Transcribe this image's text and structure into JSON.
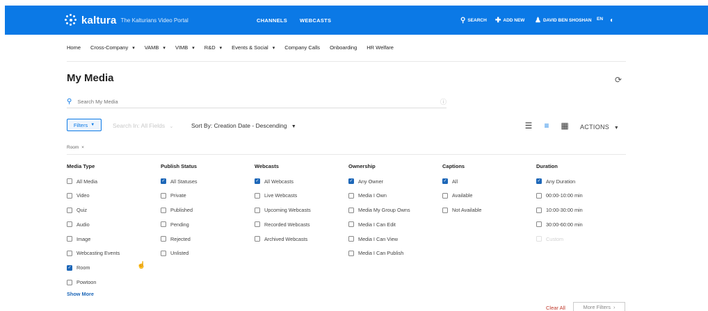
{
  "topbar": {
    "logo": "kaltura",
    "subtitle": "The Kalturians Video Portal",
    "nav": [
      "CHANNELS",
      "WEBCASTS"
    ],
    "search": "SEARCH",
    "add_new": "ADD NEW",
    "user": "DAVID BEN SHOSHAN",
    "lang": "EN",
    "accent": "#0b79e6"
  },
  "subnav": [
    {
      "label": "Home",
      "dropdown": false
    },
    {
      "label": "Cross-Company",
      "dropdown": true
    },
    {
      "label": "VAMB",
      "dropdown": true
    },
    {
      "label": "VIMB",
      "dropdown": true
    },
    {
      "label": "R&D",
      "dropdown": true
    },
    {
      "label": "Events & Social",
      "dropdown": true
    },
    {
      "label": "Company Calls",
      "dropdown": false
    },
    {
      "label": "Onboarding",
      "dropdown": false
    },
    {
      "label": "HR Welfare",
      "dropdown": false
    }
  ],
  "page": {
    "title": "My Media",
    "search_placeholder": "Search My Media",
    "filters_label": "Filters",
    "search_in": "Search In: All Fields",
    "sort_by": "Sort By: Creation Date - Descending",
    "actions": "ACTIONS",
    "active_tag": "Room",
    "show_more": "Show More",
    "clear_all": "Clear All",
    "more_filters": "More Filters"
  },
  "filters": [
    {
      "header": "Media Type",
      "options": [
        {
          "label": "All Media",
          "checked": false
        },
        {
          "label": "Video",
          "checked": false
        },
        {
          "label": "Quiz",
          "checked": false
        },
        {
          "label": "Audio",
          "checked": false
        },
        {
          "label": "Image",
          "checked": false
        },
        {
          "label": "Webcasting Events",
          "checked": false
        },
        {
          "label": "Room",
          "checked": true
        },
        {
          "label": "Powtoon",
          "checked": false
        }
      ]
    },
    {
      "header": "Publish Status",
      "options": [
        {
          "label": "All Statuses",
          "checked": true
        },
        {
          "label": "Private",
          "checked": false
        },
        {
          "label": "Published",
          "checked": false
        },
        {
          "label": "Pending",
          "checked": false
        },
        {
          "label": "Rejected",
          "checked": false
        },
        {
          "label": "Unlisted",
          "checked": false
        }
      ]
    },
    {
      "header": "Webcasts",
      "options": [
        {
          "label": "All Webcasts",
          "checked": true
        },
        {
          "label": "Live Webcasts",
          "checked": false
        },
        {
          "label": "Upcoming Webcasts",
          "checked": false
        },
        {
          "label": "Recorded Webcasts",
          "checked": false
        },
        {
          "label": "Archived Webcasts",
          "checked": false
        }
      ]
    },
    {
      "header": "Ownership",
      "options": [
        {
          "label": "Any Owner",
          "checked": true
        },
        {
          "label": "Media I Own",
          "checked": false
        },
        {
          "label": "Media My Group Owns",
          "checked": false
        },
        {
          "label": "Media I Can Edit",
          "checked": false
        },
        {
          "label": "Media I Can View",
          "checked": false
        },
        {
          "label": "Media I Can Publish",
          "checked": false
        }
      ]
    },
    {
      "header": "Captions",
      "options": [
        {
          "label": "All",
          "checked": true
        },
        {
          "label": "Available",
          "checked": false
        },
        {
          "label": "Not Available",
          "checked": false
        }
      ]
    },
    {
      "header": "Duration",
      "options": [
        {
          "label": "Any Duration",
          "checked": true
        },
        {
          "label": "00:00-10:00 min",
          "checked": false
        },
        {
          "label": "10:00-30:00 min",
          "checked": false
        },
        {
          "label": "30:00-60:00 min",
          "checked": false
        },
        {
          "label": "Custom",
          "checked": false,
          "faded": true
        }
      ]
    }
  ]
}
